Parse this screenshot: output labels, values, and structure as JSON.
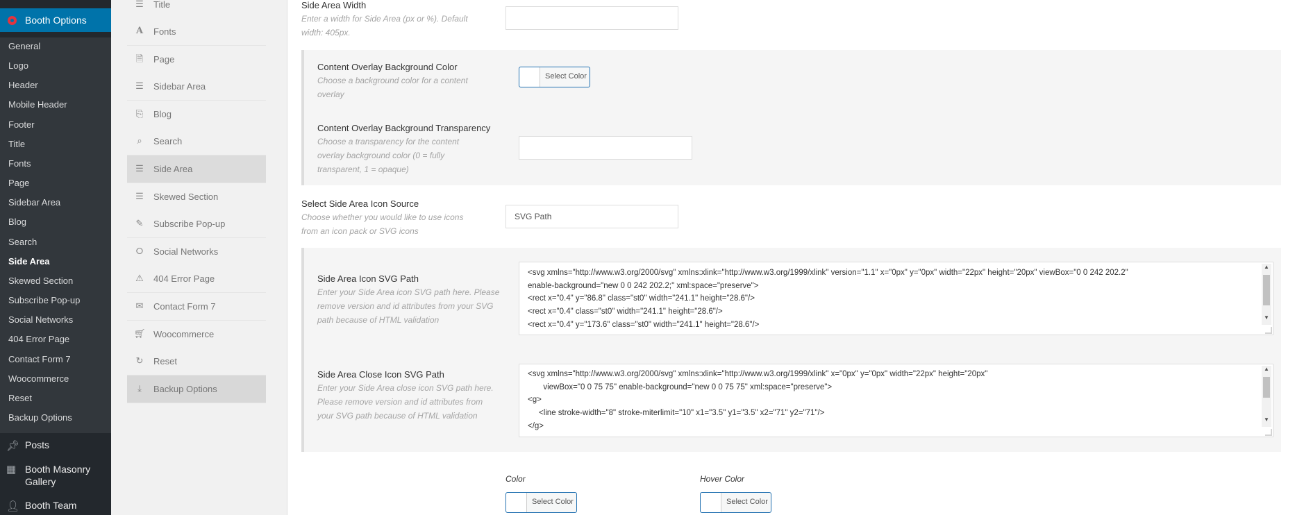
{
  "wp_sidebar": {
    "top_label": "Booth Options",
    "sub_items": [
      "General",
      "Logo",
      "Header",
      "Mobile Header",
      "Footer",
      "Title",
      "Fonts",
      "Page",
      "Sidebar Area",
      "Blog",
      "Search",
      "Side Area",
      "Skewed Section",
      "Subscribe Pop-up",
      "Social Networks",
      "404 Error Page",
      "Contact Form 7",
      "Woocommerce",
      "Reset",
      "Backup Options"
    ],
    "current_sub": "Side Area",
    "main_items": [
      {
        "label": "Posts",
        "icon": "pin-icon"
      },
      {
        "label": "Booth Masonry Gallery",
        "icon": "grid-icon"
      },
      {
        "label": "Booth Team",
        "icon": "person-icon"
      }
    ]
  },
  "options_nav": {
    "items": [
      {
        "label": "Title",
        "icon": "list-icon"
      },
      {
        "label": "Fonts",
        "icon": "font-icon"
      },
      {
        "label": "Page",
        "icon": "page-icon"
      },
      {
        "label": "Sidebar Area",
        "icon": "list-icon"
      },
      {
        "label": "Blog",
        "icon": "copy-icon"
      },
      {
        "label": "Search",
        "icon": "search-icon"
      },
      {
        "label": "Side Area",
        "icon": "list-icon"
      },
      {
        "label": "Skewed Section",
        "icon": "list-icon"
      },
      {
        "label": "Subscribe Pop-up",
        "icon": "edit-icon"
      },
      {
        "label": "Social Networks",
        "icon": "share-icon"
      },
      {
        "label": "404 Error Page",
        "icon": "warning-icon"
      },
      {
        "label": "Contact Form 7",
        "icon": "mail-icon"
      },
      {
        "label": "Woocommerce",
        "icon": "cart-icon"
      },
      {
        "label": "Reset",
        "icon": "refresh-icon"
      },
      {
        "label": "Backup Options",
        "icon": "download-icon"
      }
    ],
    "active": "Side Area"
  },
  "content": {
    "side_area_width": {
      "title": "Side Area Width",
      "desc": "Enter a width for Side Area (px or %). Default width: 405px.",
      "value": ""
    },
    "overlay_color": {
      "title": "Content Overlay Background Color",
      "desc": "Choose a background color for a content overlay",
      "button": "Select Color"
    },
    "overlay_transparency": {
      "title": "Content Overlay Background Transparency",
      "desc": "Choose a transparency for the content overlay background color (0 = fully transparent, 1 = opaque)",
      "value": ""
    },
    "icon_source": {
      "title": "Select Side Area Icon Source",
      "desc": "Choose whether you would like to use icons from an icon pack or SVG icons",
      "value": "SVG Path"
    },
    "icon_svg_path": {
      "title": "Side Area Icon SVG Path",
      "desc": "Enter your Side Area icon SVG path here. Please remove version and id attributes from your SVG path because of HTML validation",
      "code": "<svg xmlns=\"http://www.w3.org/2000/svg\" xmlns:xlink=\"http://www.w3.org/1999/xlink\" version=\"1.1\" x=\"0px\" y=\"0px\" width=\"22px\" height=\"20px\" viewBox=\"0 0 242 202.2\"\nenable-background=\"new 0 0 242 202.2;\" xml:space=\"preserve\">\n<rect x=\"0.4\" y=\"86.8\" class=\"st0\" width=\"241.1\" height=\"28.6\"/>\n<rect x=\"0.4\" class=\"st0\" width=\"241.1\" height=\"28.6\"/>\n<rect x=\"0.4\" y=\"173.6\" class=\"st0\" width=\"241.1\" height=\"28.6\"/>"
    },
    "close_svg_path": {
      "title": "Side Area Close Icon SVG Path",
      "desc": "Enter your Side Area close icon SVG path here. Please remove version and id attributes from your SVG path because of HTML validation",
      "code": "<svg xmlns=\"http://www.w3.org/2000/svg\" xmlns:xlink=\"http://www.w3.org/1999/xlink\" x=\"0px\" y=\"0px\" width=\"22px\" height=\"20px\"\n       viewBox=\"0 0 75 75\" enable-background=\"new 0 0 75 75\" xml:space=\"preserve\">\n<g>\n     <line stroke-width=\"8\" stroke-miterlimit=\"10\" x1=\"3.5\" y1=\"3.5\" x2=\"71\" y2=\"71\"/>\n</g>"
    },
    "colors": {
      "color_label": "Color",
      "hover_label": "Hover Color",
      "button": "Select Color"
    }
  }
}
